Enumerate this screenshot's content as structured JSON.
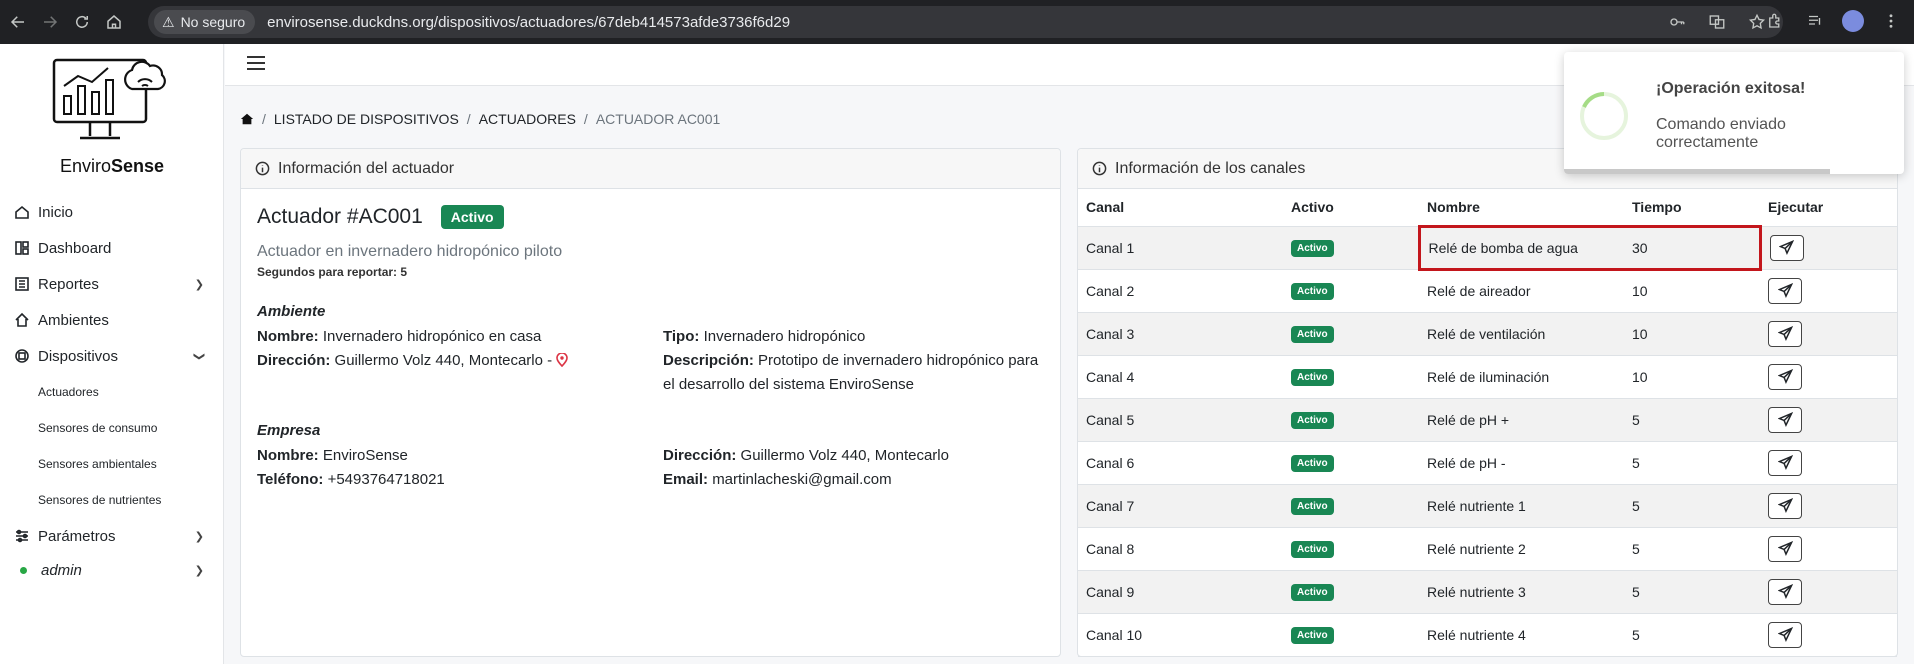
{
  "browser": {
    "secure_label": "No seguro",
    "url": "envirosense.duckdns.org/dispositivos/actuadores/67deb414573afde3736f6d29"
  },
  "brand": {
    "part1": "Enviro",
    "part2": "Sense"
  },
  "sidebar": {
    "items": [
      {
        "label": "Inicio",
        "icon": "home-icon"
      },
      {
        "label": "Dashboard",
        "icon": "dashboard-icon"
      },
      {
        "label": "Reportes",
        "icon": "reports-icon"
      },
      {
        "label": "Ambientes",
        "icon": "house-icon"
      },
      {
        "label": "Dispositivos",
        "icon": "device-icon"
      }
    ],
    "sub_items": [
      "Actuadores",
      "Sensores de consumo",
      "Sensores ambientales",
      "Sensores de nutrientes"
    ],
    "parametros": "Parámetros",
    "user": "admin"
  },
  "breadcrumb": {
    "item1": "LISTADO DE DISPOSITIVOS",
    "item2": "ACTUADORES",
    "current": "ACTUADOR AC001"
  },
  "actuator_card": {
    "header": "Información del actuador",
    "title": "Actuador #AC001",
    "status": "Activo",
    "description": "Actuador en invernadero hidropónico piloto",
    "report_seconds": "Segundos para reportar: 5",
    "ambiente": {
      "section": "Ambiente",
      "nombre_label": "Nombre:",
      "nombre": "Invernadero hidropónico en casa",
      "direccion_label": "Dirección:",
      "direccion": "Guillermo Volz 440, Montecarlo -",
      "tipo_label": "Tipo:",
      "tipo": "Invernadero hidropónico",
      "descripcion_label": "Descripción:",
      "descripcion": "Prototipo de invernadero hidropónico para el desarrollo del sistema EnviroSense"
    },
    "empresa": {
      "section": "Empresa",
      "nombre_label": "Nombre:",
      "nombre": "EnviroSense",
      "telefono_label": "Teléfono:",
      "telefono": "+5493764718021",
      "direccion_label": "Dirección:",
      "direccion": "Guillermo Volz 440, Montecarlo",
      "email_label": "Email:",
      "email": "martinlacheski@gmail.com"
    }
  },
  "channels_card": {
    "header": "Información de los canales",
    "columns": [
      "Canal",
      "Activo",
      "Nombre",
      "Tiempo",
      "Ejecutar"
    ],
    "rows": [
      {
        "canal": "Canal 1",
        "activo": "Activo",
        "nombre": "Relé de bomba de agua",
        "tiempo": "30"
      },
      {
        "canal": "Canal 2",
        "activo": "Activo",
        "nombre": "Relé de aireador",
        "tiempo": "10"
      },
      {
        "canal": "Canal 3",
        "activo": "Activo",
        "nombre": "Relé de ventilación",
        "tiempo": "10"
      },
      {
        "canal": "Canal 4",
        "activo": "Activo",
        "nombre": "Relé de iluminación",
        "tiempo": "10"
      },
      {
        "canal": "Canal 5",
        "activo": "Activo",
        "nombre": "Relé de pH +",
        "tiempo": "5"
      },
      {
        "canal": "Canal 6",
        "activo": "Activo",
        "nombre": "Relé de pH -",
        "tiempo": "5"
      },
      {
        "canal": "Canal 7",
        "activo": "Activo",
        "nombre": "Relé nutriente 1",
        "tiempo": "5"
      },
      {
        "canal": "Canal 8",
        "activo": "Activo",
        "nombre": "Relé nutriente 2",
        "tiempo": "5"
      },
      {
        "canal": "Canal 9",
        "activo": "Activo",
        "nombre": "Relé nutriente 3",
        "tiempo": "5"
      },
      {
        "canal": "Canal 10",
        "activo": "Activo",
        "nombre": "Relé nutriente 4",
        "tiempo": "5"
      }
    ]
  },
  "toast": {
    "title": "¡Operación exitosa!",
    "message": "Comando enviado correctamente"
  },
  "colors": {
    "success": "#198754",
    "highlight": "#c3161c",
    "spinner": "#a5dc86"
  }
}
